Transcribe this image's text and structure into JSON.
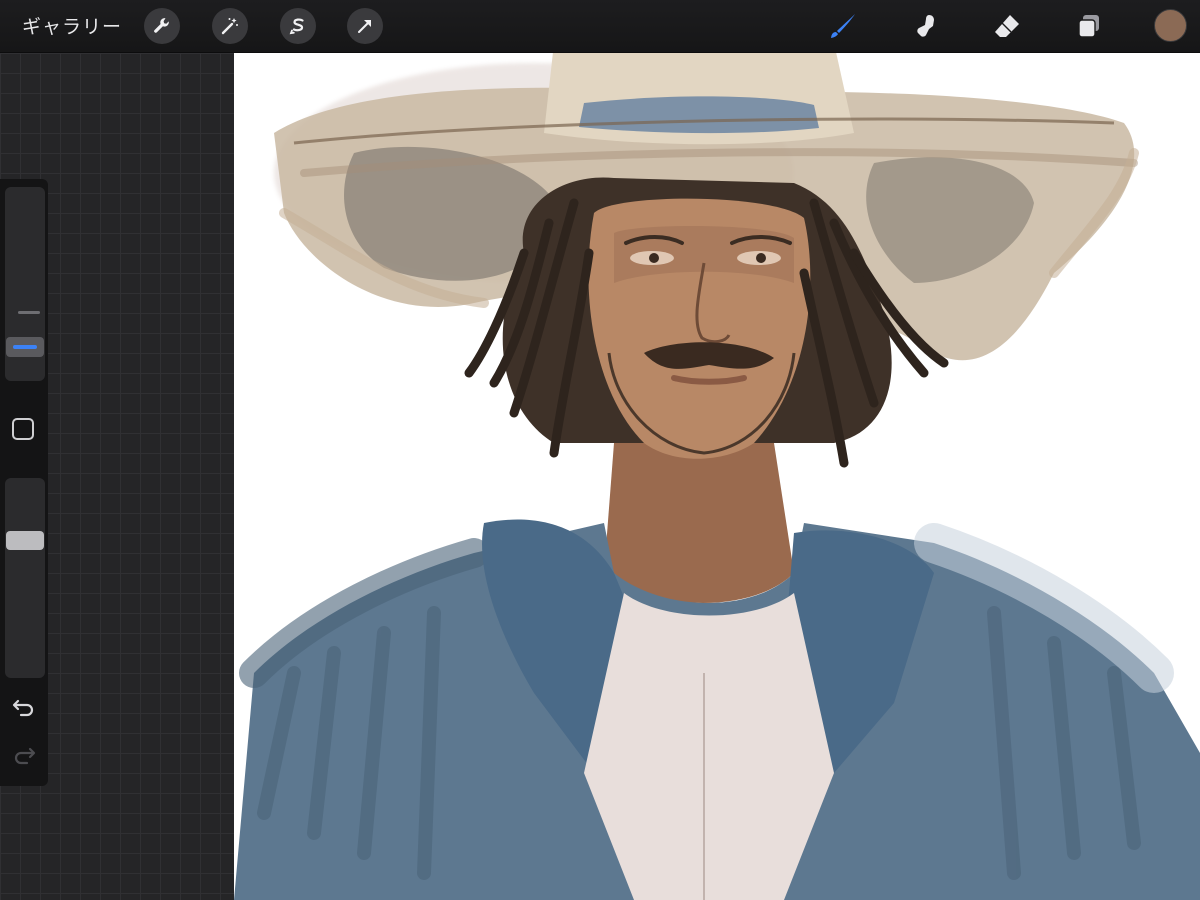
{
  "toolbar": {
    "gallery_label": "ギャラリー",
    "left_tools": [
      {
        "icon": "wrench-icon"
      },
      {
        "icon": "magic-wand-icon"
      },
      {
        "icon": "selection-icon"
      },
      {
        "icon": "transform-arrow-icon"
      }
    ],
    "right_tools": [
      {
        "icon": "brush-icon",
        "active": true
      },
      {
        "icon": "smudge-icon"
      },
      {
        "icon": "eraser-icon"
      },
      {
        "icon": "layers-icon"
      }
    ],
    "current_color": "#8b6a55",
    "accent_color": "#3c82f6"
  },
  "sidebar": {
    "undo_icon": "undo-icon",
    "redo_icon": "redo-icon",
    "modify_icon": "square-icon"
  },
  "canvas": {
    "background": "#ffffff",
    "artwork": "cowboy-portrait-painting"
  }
}
